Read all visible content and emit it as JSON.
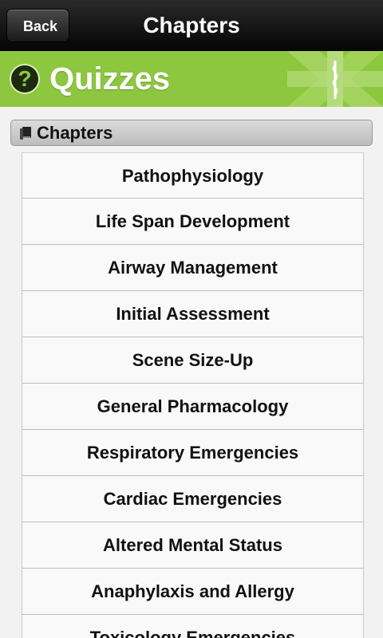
{
  "navbar": {
    "back_label": "Back",
    "title": "Chapters"
  },
  "banner": {
    "title": "Quizzes",
    "help_icon": "?",
    "color": "#8dc63f"
  },
  "section": {
    "title": "Chapters",
    "icon": "book-icon"
  },
  "chapters": [
    {
      "label": "Pathophysiology"
    },
    {
      "label": "Life Span Development"
    },
    {
      "label": "Airway Management"
    },
    {
      "label": "Initial Assessment"
    },
    {
      "label": "Scene Size-Up"
    },
    {
      "label": "General Pharmacology"
    },
    {
      "label": "Respiratory Emergencies"
    },
    {
      "label": "Cardiac Emergencies"
    },
    {
      "label": "Altered Mental Status"
    },
    {
      "label": "Anaphylaxis and Allergy"
    },
    {
      "label": "Toxicology Emergencies"
    }
  ]
}
